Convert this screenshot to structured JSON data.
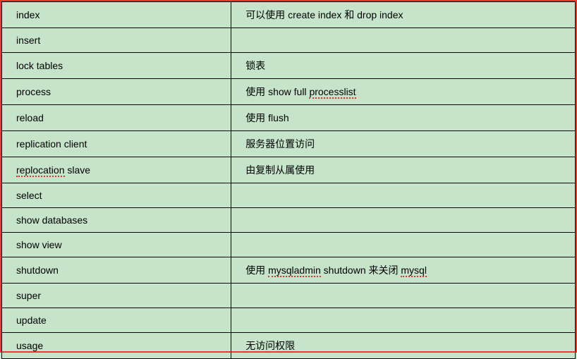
{
  "rows": [
    {
      "left_html": "index",
      "right_html": "可以使用 create index 和 drop index"
    },
    {
      "left_html": "insert",
      "right_html": ""
    },
    {
      "left_html": "lock tables",
      "right_html": "锁表"
    },
    {
      "left_html": "process",
      "right_html": "使用 show full <span class=\"spell\">processlist</span>"
    },
    {
      "left_html": "reload",
      "right_html": "使用 flush"
    },
    {
      "left_html": "replication client",
      "right_html": "服务器位置访问"
    },
    {
      "left_html": "<span class=\"spell\">replocation</span> slave",
      "right_html": "由复制从属使用"
    },
    {
      "left_html": "select",
      "right_html": ""
    },
    {
      "left_html": "show databases",
      "right_html": ""
    },
    {
      "left_html": "show view",
      "right_html": ""
    },
    {
      "left_html": "shutdown",
      "right_html": "使用 <span class=\"spell\">mysqladmin</span> shutdown 来关闭 <span class=\"spell\">mysql</span>"
    },
    {
      "left_html": "super",
      "right_html": ""
    },
    {
      "left_html": "update",
      "right_html": ""
    },
    {
      "left_html": "usage",
      "right_html": "无访问权限"
    }
  ]
}
